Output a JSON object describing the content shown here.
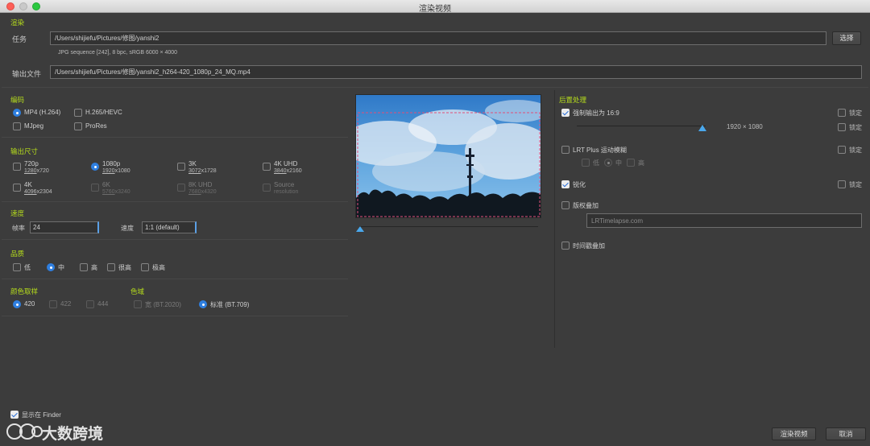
{
  "window": {
    "title": "渲染视频"
  },
  "render_section": {
    "title": "渲染",
    "task_label": "任务",
    "task_path": "/Users/shijiefu/Pictures/修图/yanshi2",
    "choose_button": "选择",
    "sequence_info": "JPG sequence [242], 8 bpc, sRGB 6000 × 4000",
    "output_label": "输出文件",
    "output_path": "/Users/shijiefu/Pictures/修图/yanshi2_h264-420_1080p_24_MQ.mp4"
  },
  "codec": {
    "title": "编码",
    "options": [
      {
        "label": "MP4 (H.264)",
        "selected": true
      },
      {
        "label": "H.265/HEVC",
        "selected": false
      },
      {
        "label": "MJpeg",
        "selected": false
      },
      {
        "label": "ProRes",
        "selected": false
      }
    ]
  },
  "output_size": {
    "title": "输出尺寸",
    "options": [
      {
        "label": "720p",
        "w": "1280",
        "h": "720",
        "selected": false,
        "enabled": true
      },
      {
        "label": "1080p",
        "w": "1920",
        "h": "1080",
        "selected": true,
        "enabled": true
      },
      {
        "label": "3K",
        "w": "3072",
        "h": "1728",
        "selected": false,
        "enabled": true
      },
      {
        "label": "4K UHD",
        "w": "3840",
        "h": "2160",
        "selected": false,
        "enabled": true
      },
      {
        "label": "4K",
        "w": "4096",
        "h": "2304",
        "selected": false,
        "enabled": true
      },
      {
        "label": "6K",
        "w": "5760",
        "h": "3240",
        "selected": false,
        "enabled": false
      },
      {
        "label": "8K UHD",
        "w": "7680",
        "h": "4320",
        "selected": false,
        "enabled": false
      },
      {
        "label": "Source",
        "w": "resolution",
        "h": "",
        "selected": false,
        "enabled": false
      }
    ]
  },
  "speed": {
    "title": "速度",
    "fps_label": "帧率",
    "fps_value": "24",
    "speed_label": "速度",
    "speed_value": "1:1 (default)"
  },
  "quality": {
    "title": "品质",
    "options": [
      {
        "label": "低",
        "selected": false
      },
      {
        "label": "中",
        "selected": true
      },
      {
        "label": "高",
        "selected": false
      },
      {
        "label": "很高",
        "selected": false
      },
      {
        "label": "极高",
        "selected": false
      }
    ]
  },
  "chroma": {
    "title": "颜色取样",
    "options": [
      {
        "label": "420",
        "selected": true,
        "enabled": true
      },
      {
        "label": "422",
        "selected": false,
        "enabled": false
      },
      {
        "label": "444",
        "selected": false,
        "enabled": false
      }
    ]
  },
  "gamut": {
    "title": "色域",
    "options": [
      {
        "label": "宽 (BT.2020)",
        "selected": false,
        "enabled": false
      },
      {
        "label": "标准 (BT.709)",
        "selected": true,
        "enabled": true
      }
    ]
  },
  "preview": {
    "slider_position": 0.0
  },
  "post": {
    "title": "后置处理",
    "force_169_label": "强制输出为 16:9",
    "force_169_checked": true,
    "resolution_readout": "1920 × 1080",
    "resolution_slider_value": 0.74,
    "lock_label": "锁定",
    "lrt_motion_label": "LRT Plus 运动模糊",
    "lrt_motion_checked": false,
    "motion_levels": [
      {
        "label": "低",
        "selected": false
      },
      {
        "label": "中",
        "selected": true
      },
      {
        "label": "高",
        "selected": false
      }
    ],
    "sharpen_label": "锐化",
    "sharpen_checked": true,
    "copyright_label": "版权叠加",
    "copyright_checked": false,
    "copyright_placeholder": "LRTimelapse.com",
    "timestamp_label": "时间戳叠加",
    "timestamp_checked": false
  },
  "footer": {
    "show_in_finder_label": "显示在 Finder",
    "show_in_finder_checked": true,
    "render_button": "渲染视频",
    "cancel_button": "取消",
    "watermark_text": "大数跨境"
  },
  "colors": {
    "section_title": "#b6dd1c",
    "accent": "#2f7fe0",
    "background": "#3c3c3c",
    "crop_guide": "#e0507a"
  }
}
